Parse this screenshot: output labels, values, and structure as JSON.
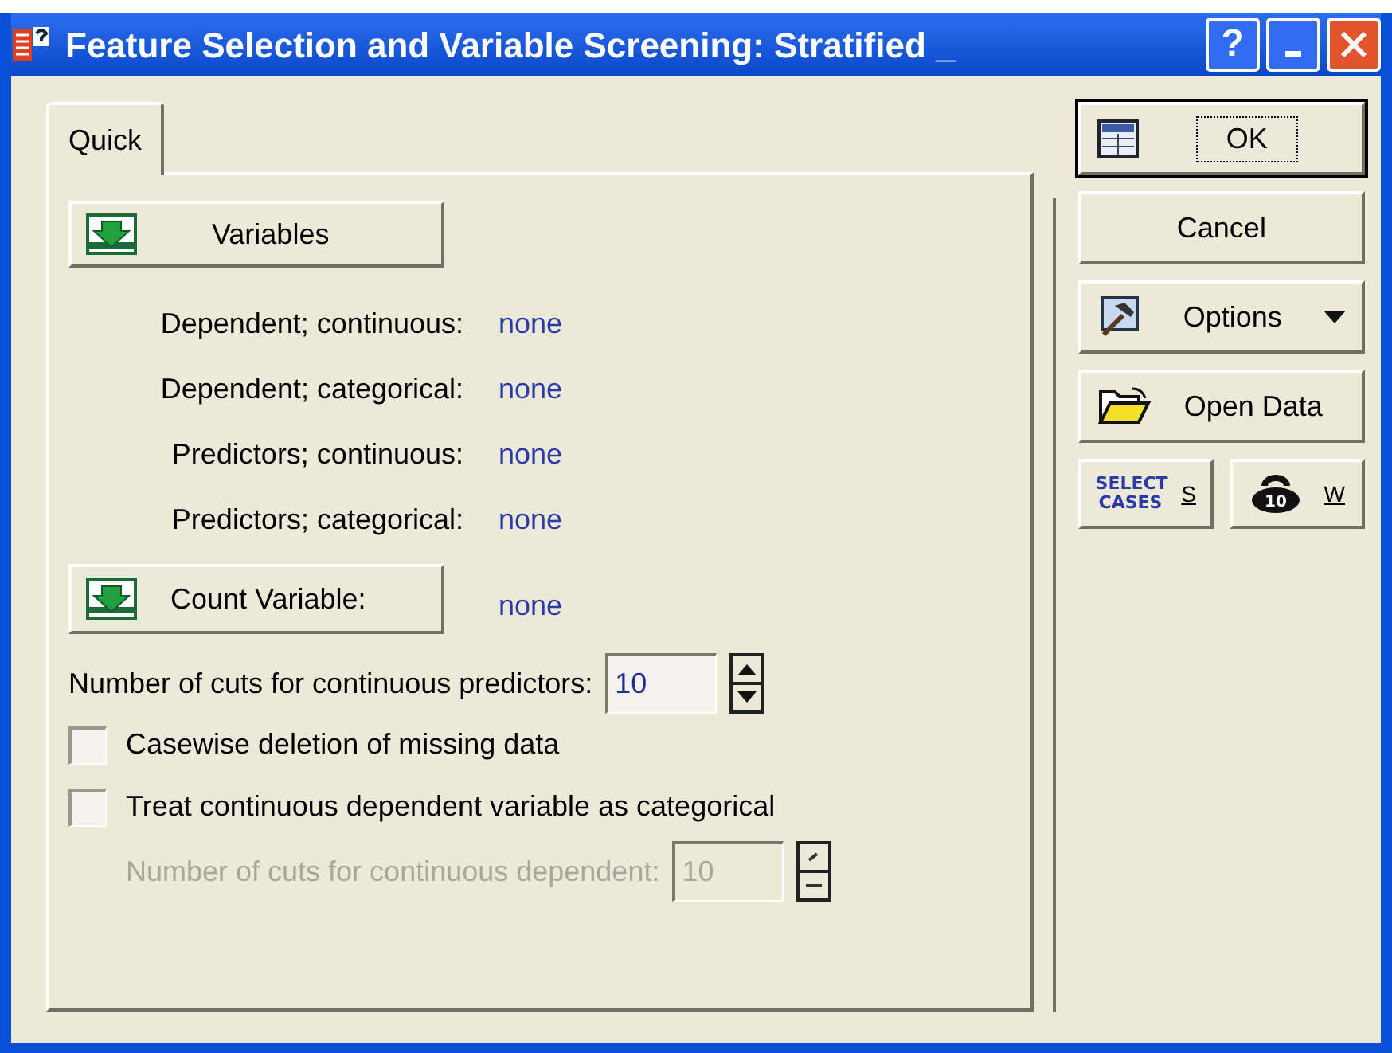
{
  "window": {
    "title": "Feature Selection and Variable Screening: Stratified _"
  },
  "title_buttons": [
    {
      "kind": "help",
      "label": "?"
    },
    {
      "kind": "minimize"
    },
    {
      "kind": "close"
    }
  ],
  "tabs": [
    {
      "label": "Quick",
      "selected": true
    }
  ],
  "variables_button": {
    "label": "Variables"
  },
  "variable_rows": [
    {
      "label": "Dependent; continuous:",
      "value": "none"
    },
    {
      "label": "Dependent; categorical:",
      "value": "none"
    },
    {
      "label": "Predictors; continuous:",
      "value": "none"
    },
    {
      "label": "Predictors; categorical:",
      "value": "none"
    }
  ],
  "count_variable": {
    "label": "Count Variable:",
    "value": "none"
  },
  "cuts_predictors": {
    "label": "Number of cuts for continuous predictors:",
    "value": "10",
    "disabled": false
  },
  "checkboxes": [
    {
      "label": "Casewise deletion of missing data",
      "checked": false
    },
    {
      "label": "Treat continuous dependent variable as categorical",
      "checked": false
    }
  ],
  "cuts_dependent": {
    "label": "Number of cuts for continuous dependent:",
    "value": "10",
    "disabled": true
  },
  "side_buttons": [
    {
      "kind": "ok",
      "label": "OK",
      "default": true
    },
    {
      "kind": "plain",
      "label": "Cancel",
      "default": false
    },
    {
      "kind": "options",
      "label": "Options",
      "default": false
    },
    {
      "kind": "open",
      "label": "Open Data",
      "default": false
    }
  ],
  "small_buttons": [
    {
      "kind": "select",
      "icon_text": "SELECT CASES",
      "label": "S"
    },
    {
      "kind": "weight",
      "icon_text": "10",
      "label": "W"
    }
  ]
}
